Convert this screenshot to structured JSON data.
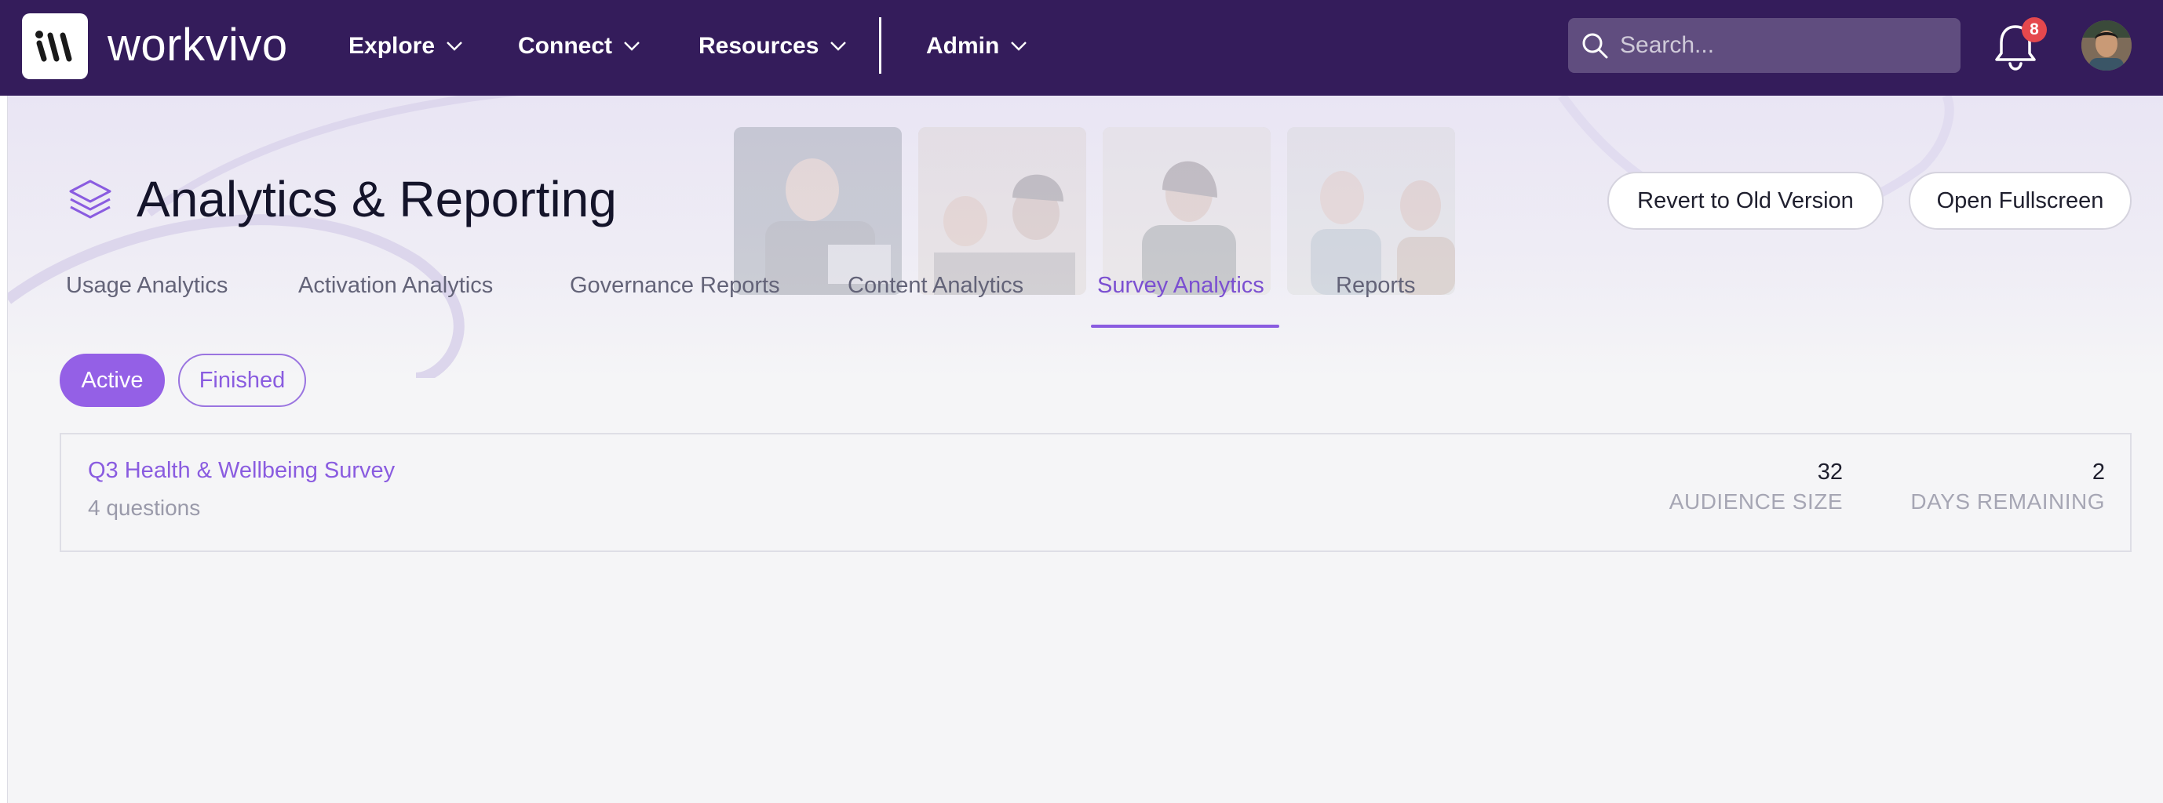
{
  "brand": {
    "name": "workvivo",
    "logo_text": "w"
  },
  "nav": {
    "items": [
      {
        "label": "Explore"
      },
      {
        "label": "Connect"
      },
      {
        "label": "Resources"
      },
      {
        "label": "Admin"
      }
    ],
    "search_placeholder": "Search...",
    "notifications_count": "8"
  },
  "page": {
    "title": "Analytics & Reporting",
    "revert_label": "Revert to Old Version",
    "fullscreen_label": "Open Fullscreen"
  },
  "tabs": [
    {
      "label": "Usage Analytics"
    },
    {
      "label": "Activation Analytics"
    },
    {
      "label": "Governance Reports"
    },
    {
      "label": "Content Analytics"
    },
    {
      "label": "Survey Analytics"
    },
    {
      "label": "Reports"
    }
  ],
  "active_tab": "Survey Analytics",
  "filters": {
    "active_label": "Active",
    "finished_label": "Finished"
  },
  "surveys": [
    {
      "title": "Q3 Health & Wellbeing Survey",
      "questions": "4 questions",
      "audience_size": "32",
      "audience_label": "AUDIENCE SIZE",
      "days_remaining": "2",
      "days_label": "DAYS REMAINING"
    }
  ],
  "colors": {
    "nav_bg": "#341c5b",
    "accent": "#8a5ce0",
    "chip_active": "#9460e6",
    "badge": "#e5484d"
  }
}
